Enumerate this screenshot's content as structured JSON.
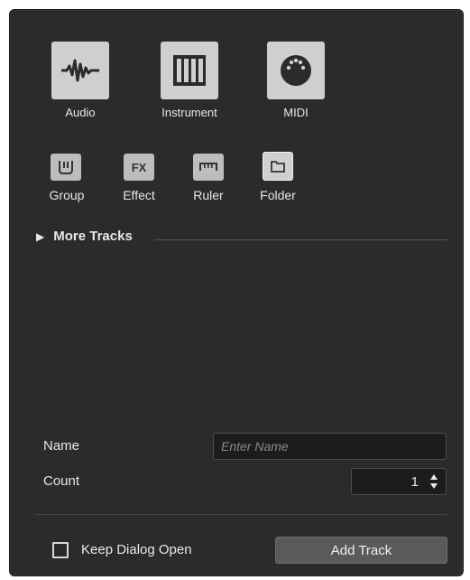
{
  "track_types": [
    {
      "label": "Audio",
      "icon": "audio-waveform-icon"
    },
    {
      "label": "Instrument",
      "icon": "piano-keys-icon"
    },
    {
      "label": "MIDI",
      "icon": "midi-connector-icon"
    }
  ],
  "small_types": [
    {
      "label": "Group",
      "icon": "group-channel-icon"
    },
    {
      "label": "Effect",
      "icon": "fx-icon",
      "glyph": "FX"
    },
    {
      "label": "Ruler",
      "icon": "ruler-icon"
    },
    {
      "label": "Folder",
      "icon": "folder-icon",
      "selected": true
    }
  ],
  "more_tracks": {
    "label": "More Tracks"
  },
  "form": {
    "name_label": "Name",
    "name_placeholder": "Enter Name",
    "name_value": "",
    "count_label": "Count",
    "count_value": "1"
  },
  "footer": {
    "keep_open_label": "Keep Dialog Open",
    "keep_open_checked": false,
    "add_button": "Add Track"
  },
  "colors": {
    "background": "#2b2b2d",
    "tile": "#cfcfcf",
    "field": "#1c1c1e",
    "button": "#5a5a5c"
  }
}
